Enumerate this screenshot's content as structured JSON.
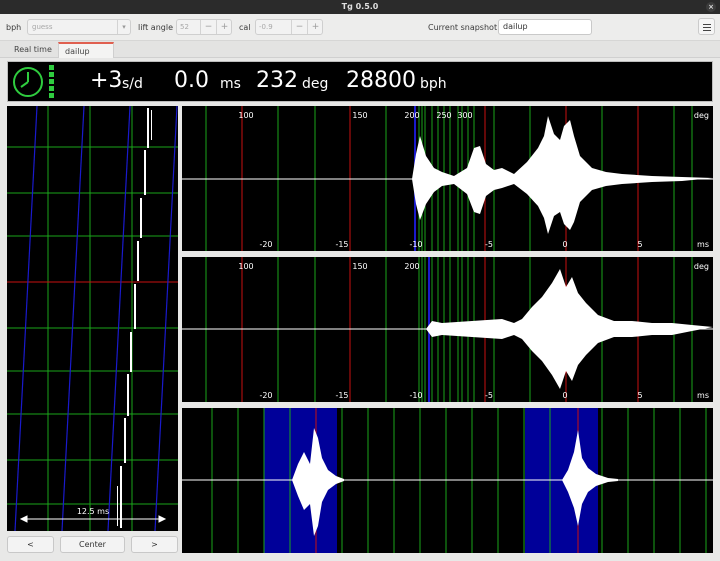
{
  "window": {
    "title": "Tg 0.5.0",
    "close_glyph": "×"
  },
  "toolbar": {
    "bph_label": "bph",
    "bph_value": "guess",
    "lift_angle_label": "lift angle",
    "lift_angle_value": "52",
    "cal_label": "cal",
    "cal_value": "-0.9",
    "snapshot_label": "Current snapshot:",
    "snapshot_value": "dailup",
    "minus": "−",
    "plus": "+",
    "dropdown_arrow": "▾"
  },
  "tabs": [
    {
      "label": "Real time"
    },
    {
      "label": "dailup",
      "close": "×"
    }
  ],
  "status": {
    "rate": "+3",
    "rate_unit": "s/d",
    "beat_error": "0.0",
    "beat_error_unit": "ms",
    "amplitude": "232",
    "amplitude_unit": "deg",
    "bph": "28800",
    "bph_unit": "bph",
    "clock_color": "#2fcc3f"
  },
  "paperstrip": {
    "scale_label": "12.5 ms",
    "btn_prev": "<",
    "btn_center": "Center",
    "btn_next": ">"
  },
  "waveforms": {
    "deg_unit": "deg",
    "ms_unit": "ms",
    "deg_ticks": [
      "100",
      "150",
      "200",
      "250",
      "300"
    ],
    "ms_ticks": [
      "-20",
      "-15",
      "-10",
      "-5",
      "0",
      "5"
    ]
  },
  "colors": {
    "grid_green": "#1aa51a",
    "grid_red": "#c81010",
    "grid_blue": "#1a1acc",
    "trace_white": "#ffffff",
    "highlight_navy": "#000099",
    "tab_accent": "#e06050"
  }
}
